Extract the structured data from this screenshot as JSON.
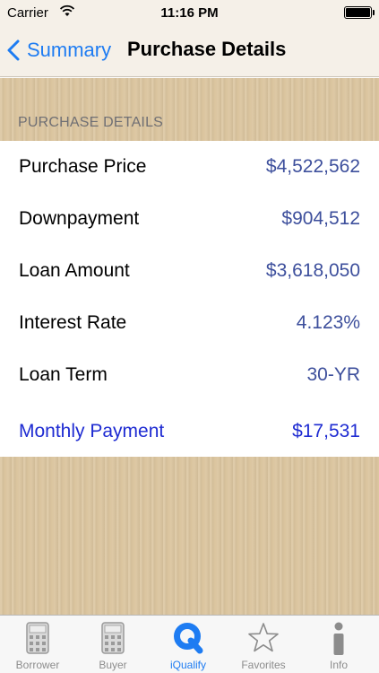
{
  "status": {
    "carrier": "Carrier",
    "time": "11:16 PM"
  },
  "nav": {
    "back_label": "Summary",
    "title": "Purchase Details"
  },
  "section": {
    "header": "PURCHASE DETAILS"
  },
  "rows": [
    {
      "label": "Purchase Price",
      "value": "$4,522,562"
    },
    {
      "label": "Downpayment",
      "value": "$904,512"
    },
    {
      "label": "Loan Amount",
      "value": "$3,618,050"
    },
    {
      "label": "Interest Rate",
      "value": "4.123%"
    },
    {
      "label": "Loan Term",
      "value": "30-YR"
    },
    {
      "label": "Monthly Payment",
      "value": "$17,531"
    }
  ],
  "tabs": [
    {
      "label": "Borrower",
      "icon": "calculator-icon"
    },
    {
      "label": "Buyer",
      "icon": "calculator-icon"
    },
    {
      "label": "iQualify",
      "icon": "q-logo-icon"
    },
    {
      "label": "Favorites",
      "icon": "star-icon"
    },
    {
      "label": "Info",
      "icon": "info-icon"
    }
  ],
  "colors": {
    "accent": "#1e7cf2",
    "value_text": "#3d4f9c",
    "total_text": "#1e2bd2"
  }
}
